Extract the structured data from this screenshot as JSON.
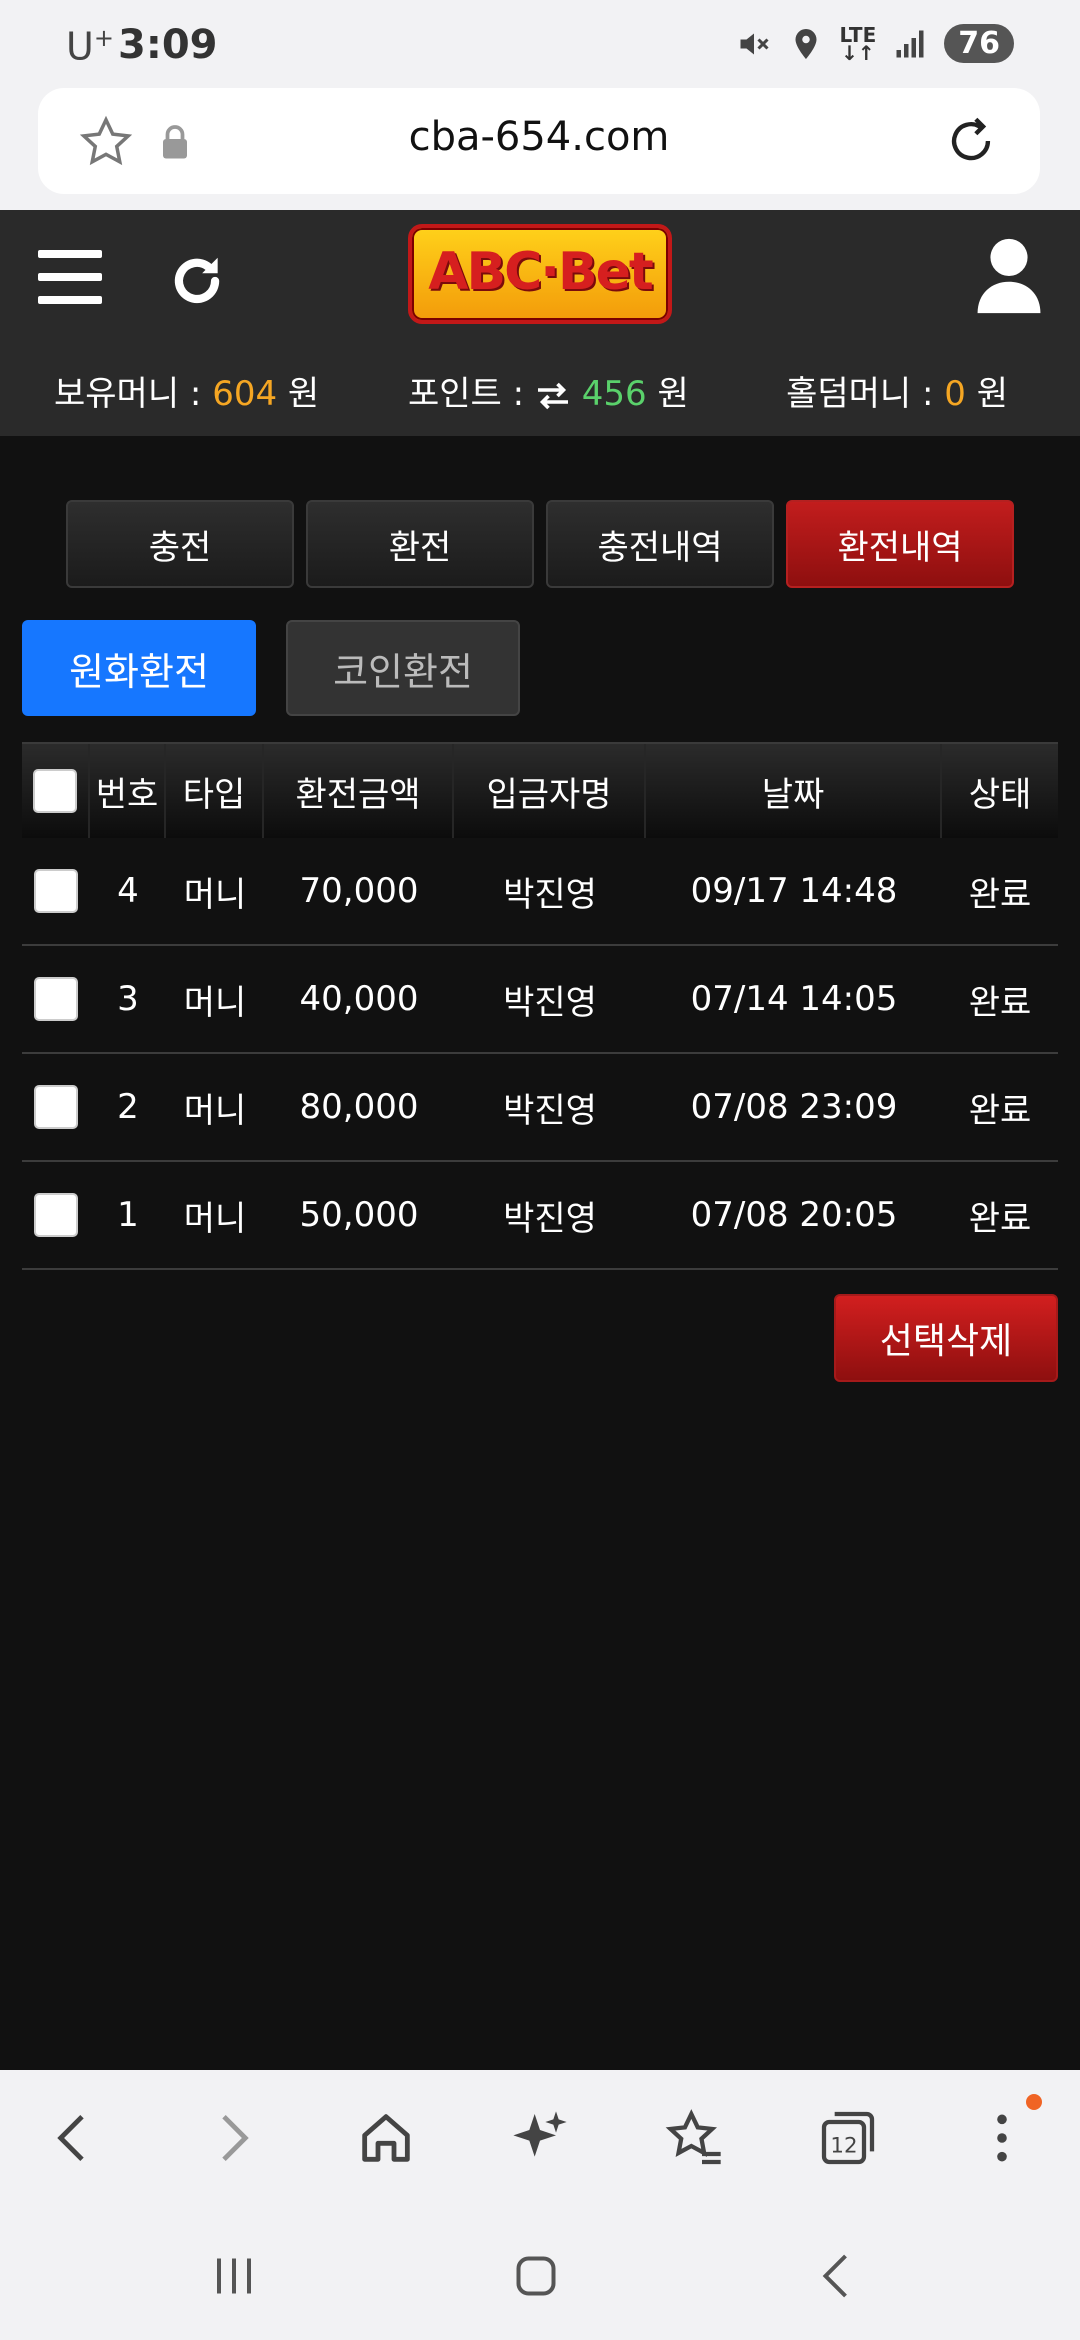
{
  "status_bar": {
    "carrier": "U",
    "carrier_sup": "+",
    "time": "3:09",
    "network": "LTE",
    "battery": "76"
  },
  "browser": {
    "url": "cba-654.com"
  },
  "header": {
    "logo": "ABC·Bet",
    "balance_label": "보유머니 : ",
    "balance_value": "604",
    "point_label": "포인트 : ",
    "point_value": "456",
    "holdem_label": "홀덤머니 : ",
    "holdem_value": "0",
    "currency": " 원"
  },
  "tabs": [
    {
      "label": "충전"
    },
    {
      "label": "환전"
    },
    {
      "label": "충전내역"
    },
    {
      "label": "환전내역"
    }
  ],
  "subtabs": [
    {
      "label": "원화환전"
    },
    {
      "label": "코인환전"
    }
  ],
  "table": {
    "columns": [
      "번호",
      "타입",
      "환전금액",
      "입금자명",
      "날짜",
      "상태"
    ],
    "rows": [
      {
        "no": "4",
        "type": "머니",
        "amount": "70,000",
        "name": "박진영",
        "date": "09/17 14:48",
        "status": "완료"
      },
      {
        "no": "3",
        "type": "머니",
        "amount": "40,000",
        "name": "박진영",
        "date": "07/14 14:05",
        "status": "완료"
      },
      {
        "no": "2",
        "type": "머니",
        "amount": "80,000",
        "name": "박진영",
        "date": "07/08 23:09",
        "status": "완료"
      },
      {
        "no": "1",
        "type": "머니",
        "amount": "50,000",
        "name": "박진영",
        "date": "07/08 20:05",
        "status": "완료"
      }
    ]
  },
  "actions": {
    "delete_selected": "선택삭제"
  },
  "bottom_bar": {
    "tab_count": "12"
  },
  "colors": {
    "accent_blue": "#1677ff",
    "accent_red": "#c21d1d",
    "money_orange": "#f5a623",
    "point_green": "#5ad16b"
  }
}
